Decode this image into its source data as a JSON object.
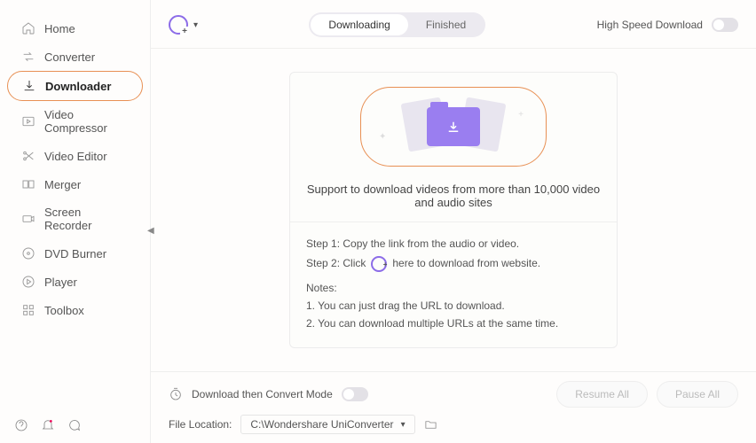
{
  "sidebar": {
    "items": [
      {
        "label": "Home"
      },
      {
        "label": "Converter"
      },
      {
        "label": "Downloader"
      },
      {
        "label": "Video Compressor"
      },
      {
        "label": "Video Editor"
      },
      {
        "label": "Merger"
      },
      {
        "label": "Screen Recorder"
      },
      {
        "label": "DVD Burner"
      },
      {
        "label": "Player"
      },
      {
        "label": "Toolbox"
      }
    ]
  },
  "topbar": {
    "tabs": {
      "downloading": "Downloading",
      "finished": "Finished"
    },
    "hsd": "High Speed Download"
  },
  "panel": {
    "support": "Support to download videos from more than 10,000 video and audio sites",
    "step1": "Step 1: Copy the link from the audio or video.",
    "step2_a": "Step 2: Click",
    "step2_b": "here to download from website.",
    "notes_h": "Notes:",
    "note1": "1. You can just drag the URL to download.",
    "note2": "2. You can download multiple URLs at the same time."
  },
  "bottom": {
    "convert_mode": "Download then Convert Mode",
    "loc_label": "File Location:",
    "loc_path": "C:\\Wondershare UniConverter",
    "resume": "Resume All",
    "pause": "Pause All"
  }
}
